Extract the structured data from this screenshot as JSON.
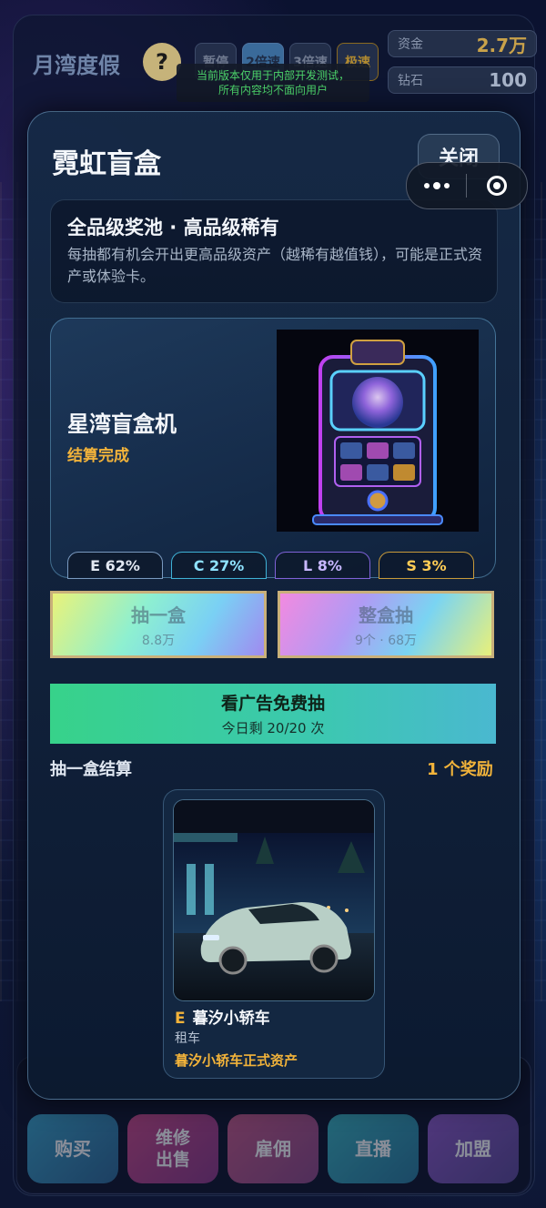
{
  "app": {
    "title": "月湾度假",
    "help_label": "?",
    "dev_notice_line1": "当前版本仅用于内部开发测试，",
    "dev_notice_line2": "所有内容均不面向用户",
    "speed_tabs": [
      "暂停",
      "2倍速",
      "3倍速",
      "极速"
    ],
    "stats": {
      "funds_label": "资金",
      "funds_value": "2.7万",
      "gems_label": "钻石",
      "gems_value": "100"
    },
    "bottom_nav": [
      "购买",
      "维修\n出售",
      "雇佣",
      "直播",
      "加盟"
    ]
  },
  "modal": {
    "title": "霓虹盲盒",
    "close_label": "关闭",
    "info_title": "全品级奖池 · 高品级稀有",
    "info_desc": "每抽都有机会开出更高品级资产（越稀有越值钱），可能是正式资产或体验卡。",
    "machine_name": "星湾盲盒机",
    "machine_status": "结算完成",
    "rarities": [
      {
        "label": "E 62%",
        "tier": "E",
        "color": "#e2e8f2"
      },
      {
        "label": "C 27%",
        "tier": "C",
        "color": "#8fe3ff"
      },
      {
        "label": "L 8%",
        "tier": "L",
        "color": "#c8b8ff"
      },
      {
        "label": "S 3%",
        "tier": "S",
        "color": "#ffcc55"
      }
    ],
    "draw_one": {
      "label": "抽一盒",
      "price": "8.8万"
    },
    "draw_box": {
      "label": "整盒抽",
      "price": "9个 · 68万"
    },
    "ad_draw": {
      "label": "看广告免费抽",
      "remaining": "今日剩 20/20 次"
    },
    "result_label": "抽一盒结算",
    "result_count": "1 个奖励",
    "reward": {
      "tier": "E",
      "name": "暮汐小轿车",
      "type": "租车",
      "desc": "暮汐小轿车正式资产"
    }
  }
}
